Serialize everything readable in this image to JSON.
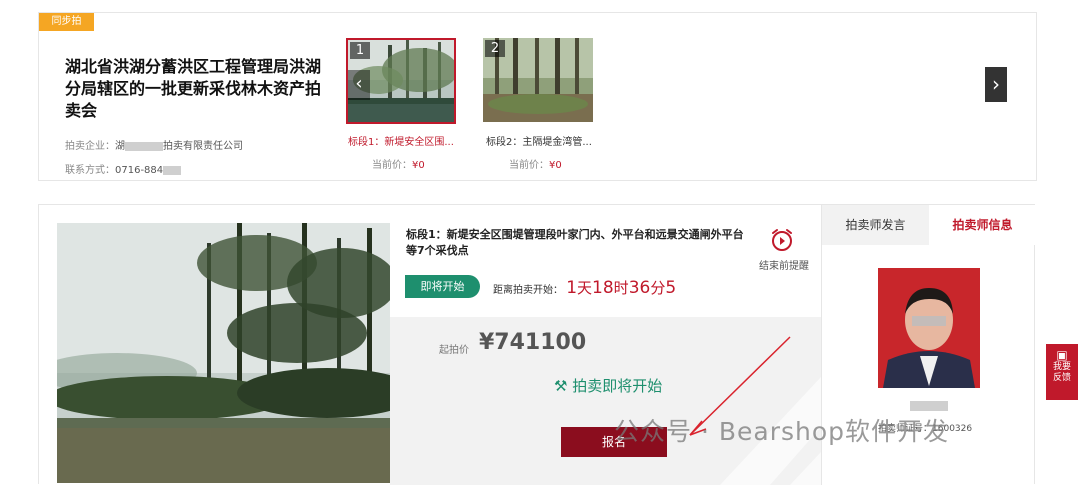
{
  "top": {
    "tag": "同步拍",
    "title": "湖北省洪湖分蓄洪区工程管理局洪湖分局辖区的一批更新采伐林木资产拍卖会",
    "company_label": "拍卖企业：",
    "company_prefix": "湖",
    "company_suffix": "拍卖有限责任公司",
    "contact_label": "联系方式：",
    "contact_value": "0716-884",
    "lots": [
      {
        "num": "1",
        "label": "标段1：新堤安全区围...",
        "price_label": "当前价：",
        "price": "¥0"
      },
      {
        "num": "2",
        "label": "标段2：主隔堤金湾管...",
        "price_label": "当前价：",
        "price": "¥0"
      }
    ]
  },
  "main": {
    "lot_title": "标段1：新堤安全区围堤管理段叶家门内、外平台和远景交通闸外平台等7个采伐点",
    "reminder": "结束前提醒",
    "status": "即将开始",
    "countdown_label": "距离拍卖开始：",
    "countdown": {
      "d": "1",
      "d_unit": "天",
      "h": "18",
      "h_unit": "时",
      "m": "36",
      "m_unit": "分",
      "s": "5"
    },
    "start_label": "起拍价",
    "start_price": "¥741100",
    "soon_text": "拍卖即将开始",
    "signup": "报名"
  },
  "side": {
    "tab_speech": "拍卖师发言",
    "tab_info": "拍卖师信息",
    "cert_label": "拍卖师证号：",
    "cert_value": "1600326"
  },
  "feedback": {
    "line1": "我要",
    "line2": "反馈"
  },
  "watermark": "公众号 · Bearshop软件开发",
  "colors": {
    "brand_red": "#c0192b",
    "status_green": "#1e8f6e",
    "tag_orange": "#f5a623",
    "signup_red": "#8b0d1e"
  }
}
